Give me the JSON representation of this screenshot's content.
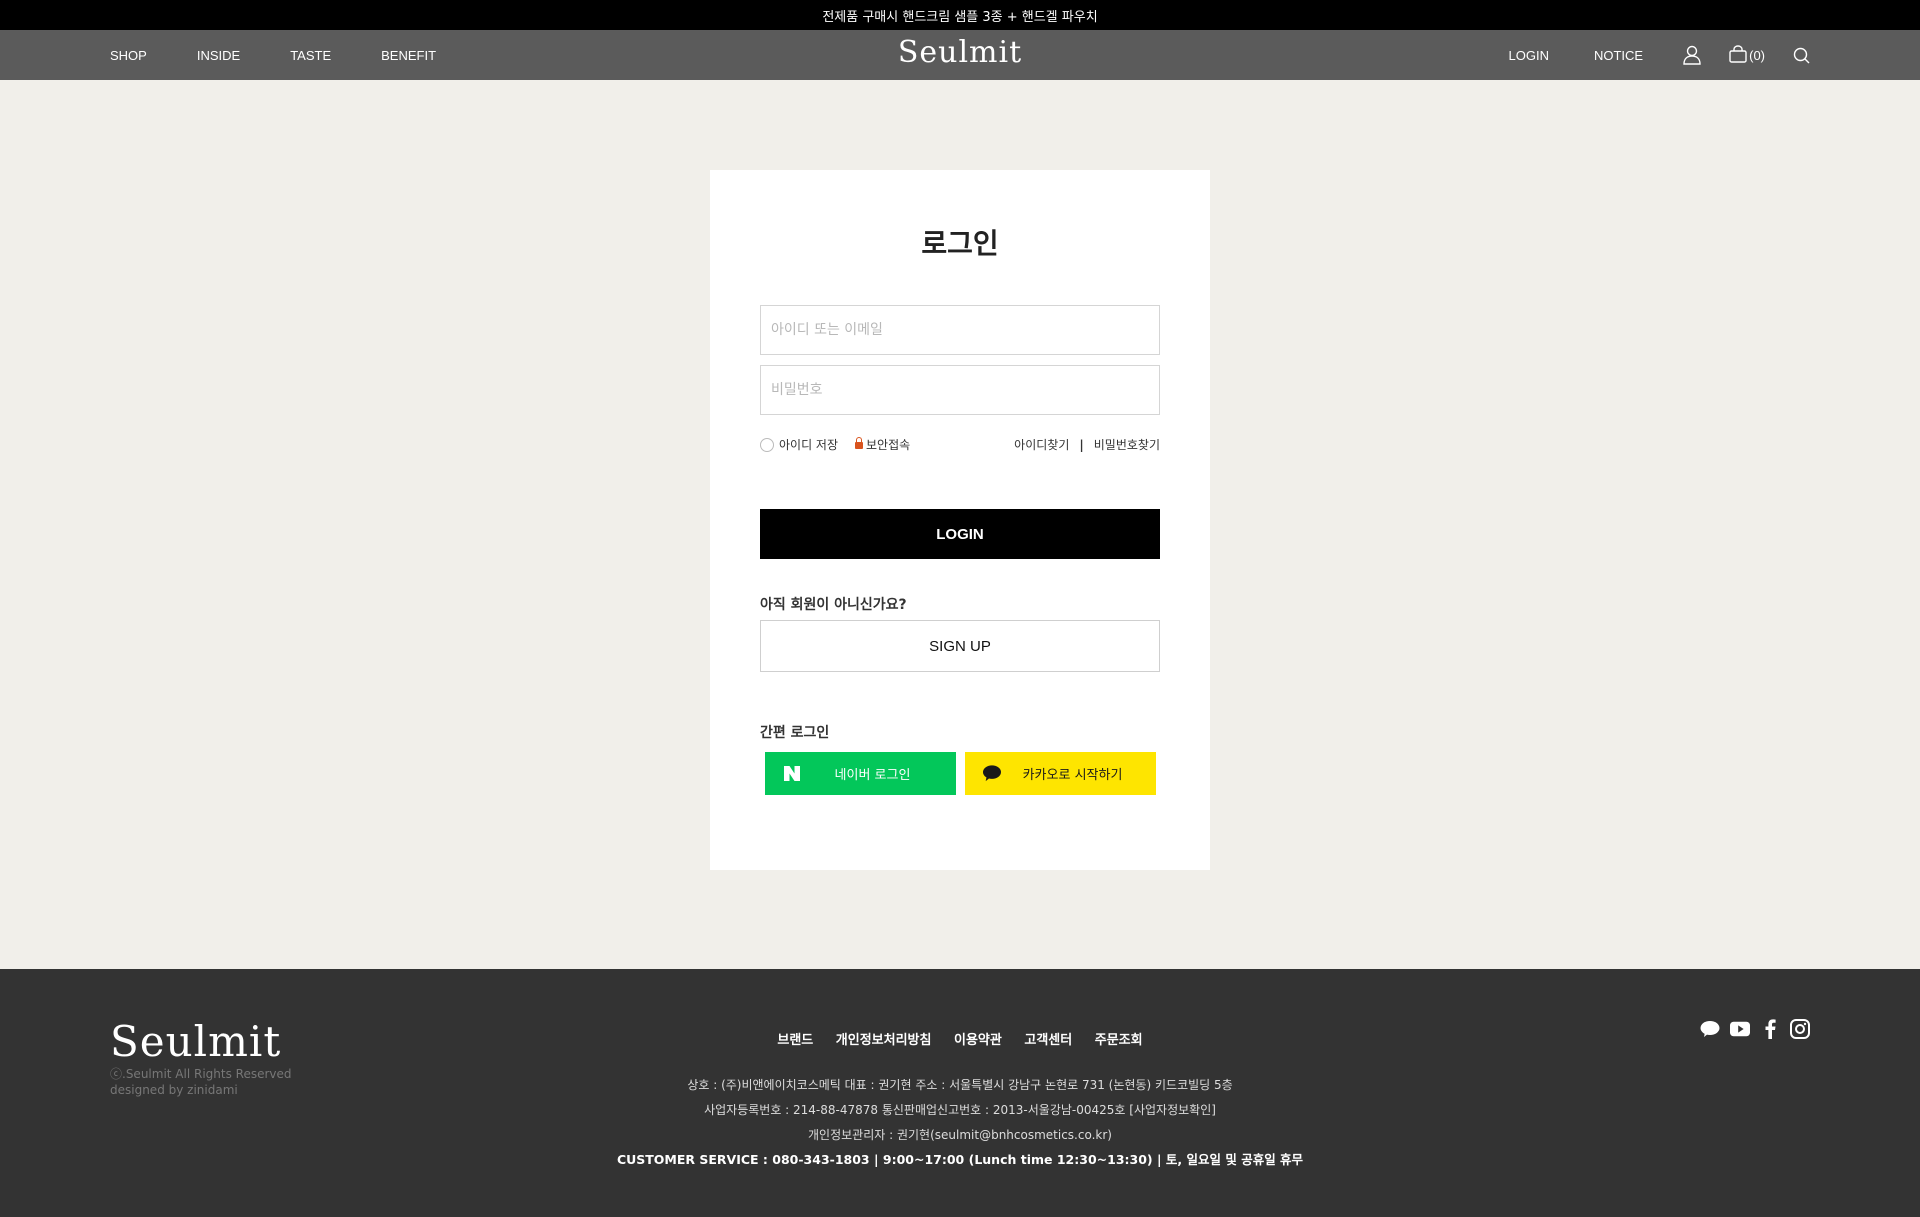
{
  "announcement": "전제품 구매시 핸드크림 샘플 3종 + 핸드겔 파우치",
  "nav": {
    "menu": [
      "SHOP",
      "INSIDE",
      "TASTE",
      "BENEFIT"
    ],
    "logo": "Seulmit",
    "login": "LOGIN",
    "notice": "NOTICE",
    "cart_count": "(0)",
    "icons": [
      "user-icon",
      "cart-icon",
      "search-icon"
    ]
  },
  "login_form": {
    "title": "로그인",
    "id_placeholder": "아이디 또는 이메일",
    "pw_placeholder": "비밀번호",
    "save_id": "아이디 저장",
    "secure": "보안접속",
    "find_id": "아이디찾기",
    "separator": "|",
    "find_pw": "비밀번호찾기",
    "login_button": "LOGIN",
    "signup_question": "아직 회원이 아니신가요?",
    "signup_button": "SIGN UP",
    "simple_login": "간편 로그인",
    "naver": "네이버 로그인",
    "kakao": "카카오로 시작하기"
  },
  "footer": {
    "logo": "Seulmit",
    "copyright": "ⓒ.Seulmit All Rights Reserved",
    "designed": "designed by zinidami",
    "links": [
      "브랜드",
      "개인정보처리방침",
      "이용약관",
      "고객센터",
      "주문조회"
    ],
    "info1": "상호 : (주)비앤에이치코스메틱    대표 : 권기현    주소 : 서울특별시 강남구 논현로 731 (논현동) 키드코빌딩 5층",
    "info2": "사업자등록번호 : 214-88-47878    통신판매업신고번호 : 2013-서울강남-00425호 [사업자정보확인]",
    "info3": "개인정보관리자 : 권기현(seulmit@bnhcosmetics.co.kr)",
    "customer_service": "CUSTOMER SERVICE : 080-343-1803  |  9:00~17:00 (Lunch time 12:30~13:30)  |  토, 일요일 및 공휴일 휴무",
    "social": [
      "kakao-talk-icon",
      "youtube-icon",
      "facebook-icon",
      "instagram-icon"
    ]
  },
  "colors": {
    "page_bg": "#f1efea",
    "nav_bg": "#5b5b5b",
    "footer_bg": "#333333",
    "naver_green": "#03c75a",
    "kakao_yellow": "#fee500"
  }
}
